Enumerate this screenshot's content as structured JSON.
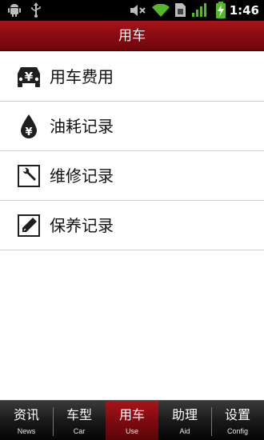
{
  "status_bar": {
    "time": "1:46",
    "icons": [
      "android-debug-icon",
      "usb-icon",
      "mute-icon",
      "wifi-icon",
      "sim-icon",
      "signal-icon",
      "battery-charging-icon"
    ]
  },
  "header": {
    "title": "用车"
  },
  "menu": {
    "items": [
      {
        "label": "用车费用",
        "icon": "car-expense-icon"
      },
      {
        "label": "油耗记录",
        "icon": "fuel-drop-icon"
      },
      {
        "label": "维修记录",
        "icon": "wrench-icon"
      },
      {
        "label": "保养记录",
        "icon": "pencil-icon"
      }
    ]
  },
  "tabs": [
    {
      "label": "资讯",
      "sub": "News",
      "active": false
    },
    {
      "label": "车型",
      "sub": "Car",
      "active": false
    },
    {
      "label": "用车",
      "sub": "Use",
      "active": true
    },
    {
      "label": "助理",
      "sub": "Aid",
      "active": false
    },
    {
      "label": "设置",
      "sub": "Config",
      "active": false
    }
  ],
  "colors": {
    "accent": "#8a0c12",
    "tab_bar": "#1a1a1a",
    "divider": "#cfcfcf"
  }
}
